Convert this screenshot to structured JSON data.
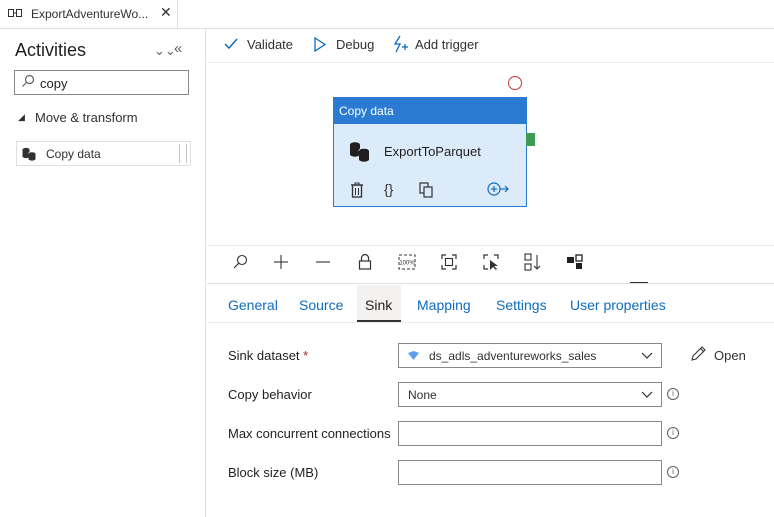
{
  "tab": {
    "title": "ExportAdventureWo...",
    "close": "✕"
  },
  "activities": {
    "title": "Activities",
    "search": {
      "value": "copy"
    },
    "group": "Move & transform",
    "items": [
      {
        "label": "Copy data"
      }
    ]
  },
  "toolbar": {
    "validate": "Validate",
    "debug": "Debug",
    "add_trigger": "Add trigger"
  },
  "node": {
    "type": "Copy data",
    "name": "ExportToParquet",
    "code_icon": "{}"
  },
  "canvas_controls": {
    "icons": [
      "search-icon",
      "zoom-in-icon",
      "zoom-out-icon",
      "lock-icon",
      "zoom-100-icon",
      "fit-to-window-icon",
      "select-icon",
      "auto-align-icon",
      "layout-icon"
    ],
    "zoom_100_label": "100%"
  },
  "properties": {
    "tabs": [
      "General",
      "Source",
      "Sink",
      "Mapping",
      "Settings",
      "User properties"
    ],
    "active_tab": "Sink",
    "fields": {
      "sink_dataset": {
        "label": "Sink dataset",
        "required_mark": "*",
        "value": "ds_adls_adventureworks_sales",
        "open_label": "Open"
      },
      "copy_behavior": {
        "label": "Copy behavior",
        "value": "None"
      },
      "max_concurrent": {
        "label": "Max concurrent connections",
        "value": ""
      },
      "block_size": {
        "label": "Block size (MB)",
        "value": ""
      }
    }
  },
  "colors": {
    "accent": "#2a7bd1",
    "node_body": "#dcebf9",
    "link": "#0f6cbd",
    "required": "#a4262c",
    "success": "#3c9c52",
    "failure": "#d13438"
  }
}
